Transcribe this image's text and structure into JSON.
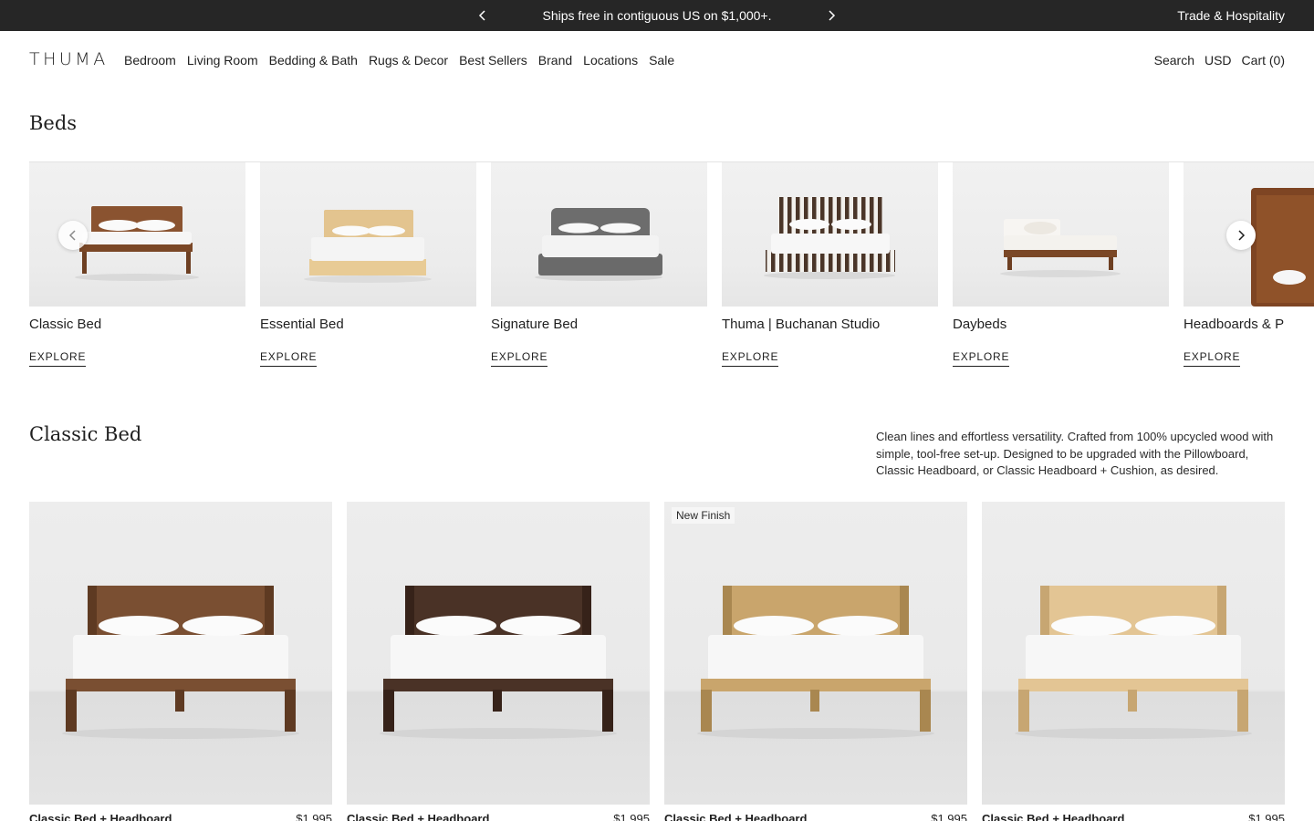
{
  "announcement": {
    "message": "Ships free in contiguous US on $1,000+.",
    "trade_link": "Trade & Hospitality"
  },
  "header": {
    "logo": "THUMA",
    "nav": [
      "Bedroom",
      "Living Room",
      "Bedding & Bath",
      "Rugs & Decor",
      "Best Sellers",
      "Brand",
      "Locations",
      "Sale"
    ],
    "search_label": "Search",
    "currency_label": "USD",
    "cart_label": "Cart (0)"
  },
  "beds_section": {
    "title": "Beds",
    "categories": [
      {
        "name": "Classic Bed",
        "cta": "EXPLORE"
      },
      {
        "name": "Essential Bed",
        "cta": "EXPLORE"
      },
      {
        "name": "Signature Bed",
        "cta": "EXPLORE"
      },
      {
        "name": "Thuma | Buchanan Studio",
        "cta": "EXPLORE"
      },
      {
        "name": "Daybeds",
        "cta": "EXPLORE"
      },
      {
        "name": "Headboards & P",
        "cta": "EXPLORE"
      }
    ]
  },
  "classic_section": {
    "title": "Classic Bed",
    "description": "Clean lines and effortless versatility. Crafted from 100% upcycled wood with simple, tool-free set-up. Designed to be upgraded with the Pillowboard, Classic Headboard, or Classic Headboard + Cushion, as desired.",
    "products": [
      {
        "name": "Classic Bed + Headboard",
        "price": "$1,995",
        "badge": "",
        "wood": "#7a4f32",
        "wood_dark": "#5e3a22"
      },
      {
        "name": "Classic Bed + Headboard",
        "price": "$1,995",
        "badge": "",
        "wood": "#4a3226",
        "wood_dark": "#362219"
      },
      {
        "name": "Classic Bed + Headboard",
        "price": "$1,995",
        "badge": "New Finish",
        "wood": "#c9a56c",
        "wood_dark": "#a98750"
      },
      {
        "name": "Classic Bed + Headboard",
        "price": "$1,995",
        "badge": "",
        "wood": "#e3c594",
        "wood_dark": "#c7a672"
      }
    ]
  },
  "colors": {
    "announcement_bg": "#262626",
    "text": "#1f1f1f"
  }
}
